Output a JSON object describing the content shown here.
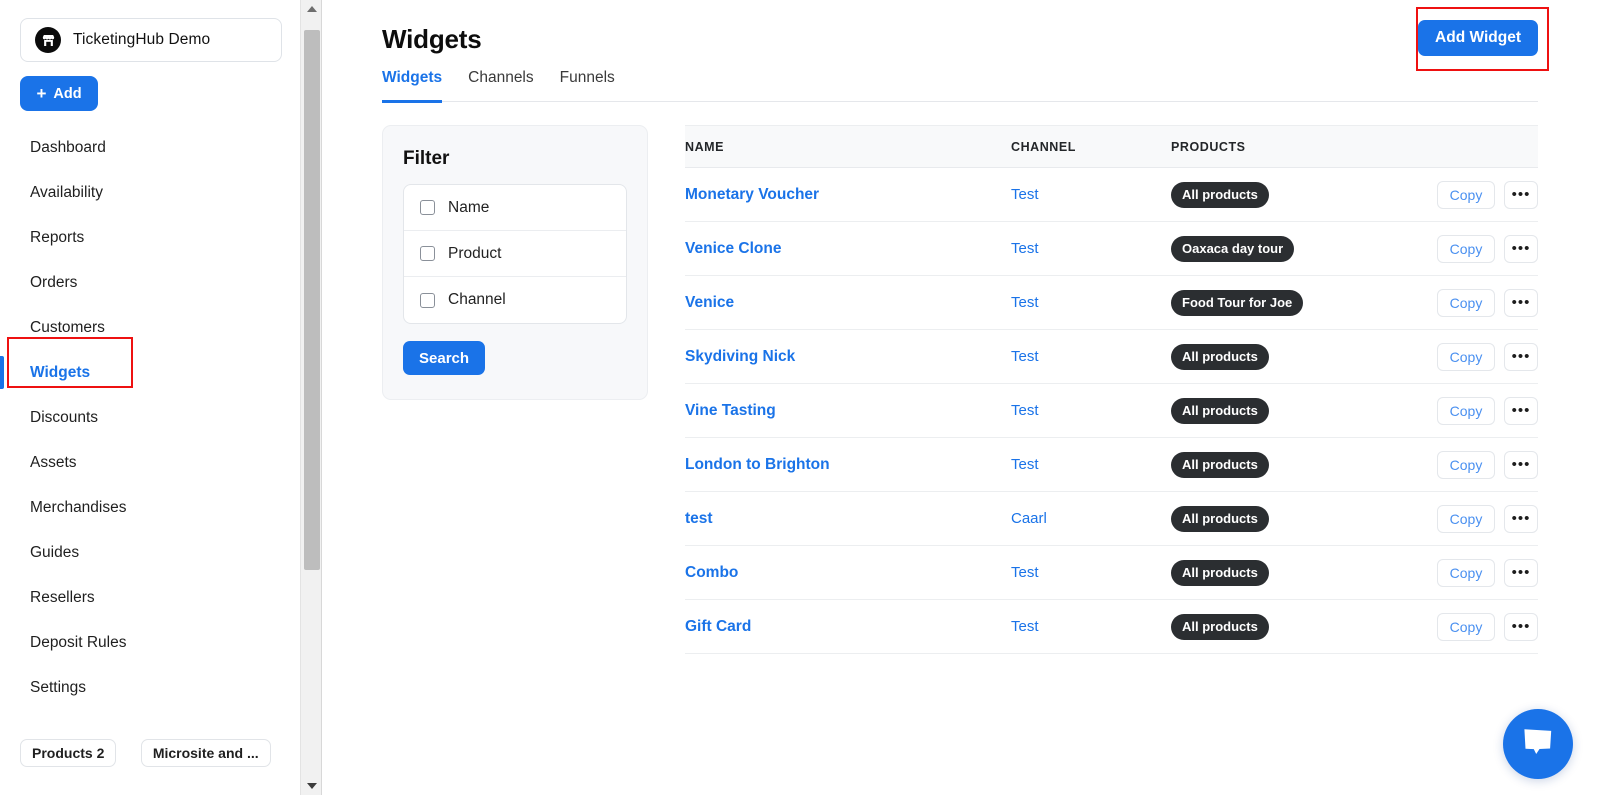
{
  "sidebar": {
    "brand": {
      "name": "TicketingHub Demo",
      "logo_icon": "storefront-icon"
    },
    "add_button": {
      "label": "Add",
      "icon": "plus-icon"
    },
    "items": [
      {
        "label": "Dashboard",
        "active": false
      },
      {
        "label": "Availability",
        "active": false
      },
      {
        "label": "Reports",
        "active": false
      },
      {
        "label": "Orders",
        "active": false
      },
      {
        "label": "Customers",
        "active": false
      },
      {
        "label": "Widgets",
        "active": true
      },
      {
        "label": "Discounts",
        "active": false
      },
      {
        "label": "Assets",
        "active": false
      },
      {
        "label": "Merchandises",
        "active": false
      },
      {
        "label": "Guides",
        "active": false
      },
      {
        "label": "Resellers",
        "active": false
      },
      {
        "label": "Deposit Rules",
        "active": false
      },
      {
        "label": "Settings",
        "active": false
      }
    ],
    "pills": [
      {
        "label": "Products 2"
      }
    ],
    "clipped_pill": {
      "label": "Microsite and ..."
    }
  },
  "scrollbar": {
    "up_arrow_icon": "triangle-up-icon",
    "down_arrow_icon": "triangle-down-icon"
  },
  "header": {
    "title": "Widgets",
    "add_widget_label": "Add Widget"
  },
  "tabs": [
    {
      "label": "Widgets",
      "active": true
    },
    {
      "label": "Channels",
      "active": false
    },
    {
      "label": "Funnels",
      "active": false
    }
  ],
  "filter": {
    "title": "Filter",
    "options": [
      {
        "label": "Name",
        "checked": false
      },
      {
        "label": "Product",
        "checked": false
      },
      {
        "label": "Channel",
        "checked": false
      }
    ],
    "search_label": "Search"
  },
  "table": {
    "columns": [
      "NAME",
      "CHANNEL",
      "PRODUCTS",
      ""
    ],
    "row_actions": {
      "copy_label": "Copy",
      "more_label": "•••"
    },
    "rows": [
      {
        "name": "Monetary Voucher",
        "channel": "Test",
        "product": "All products"
      },
      {
        "name": "Venice Clone",
        "channel": "Test",
        "product": "Oaxaca day tour"
      },
      {
        "name": "Venice",
        "channel": "Test",
        "product": "Food Tour for Joe"
      },
      {
        "name": "Skydiving Nick",
        "channel": "Test",
        "product": "All products"
      },
      {
        "name": "Vine Tasting",
        "channel": "Test",
        "product": "All products"
      },
      {
        "name": "London to Brighton",
        "channel": "Test",
        "product": "All products"
      },
      {
        "name": "test",
        "channel": "Caarl",
        "product": "All products"
      },
      {
        "name": "Combo",
        "channel": "Test",
        "product": "All products"
      },
      {
        "name": "Gift Card",
        "channel": "Test",
        "product": "All products"
      }
    ]
  },
  "chat": {
    "icon": "chat-bubble-icon"
  },
  "colors": {
    "accent_blue": "#1a73e8",
    "chip_dark": "#2b2e31",
    "annotation_red": "#ee1111",
    "table_header_bg": "#f8f9fa",
    "filter_panel_bg": "#f7f8fa"
  }
}
